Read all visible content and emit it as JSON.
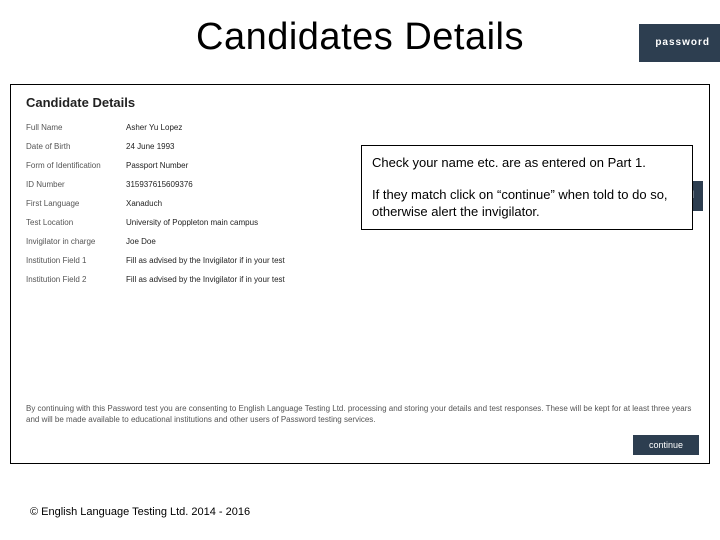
{
  "title": "Candidates Details",
  "logo_text": "password",
  "section_heading": "Candidate Details",
  "details": {
    "items": [
      {
        "label": "Full Name",
        "value": "Asher Yu Lopez"
      },
      {
        "label": "Date of Birth",
        "value": "24 June 1993"
      },
      {
        "label": "Form of Identification",
        "value": "Passport Number"
      },
      {
        "label": "ID Number",
        "value": "315937615609376"
      },
      {
        "label": "First Language",
        "value": "Xanaduch"
      },
      {
        "label": "Test Location",
        "value": "University of Poppleton main campus"
      },
      {
        "label": "Invigilator in charge",
        "value": "Joe Doe"
      },
      {
        "label": "Institution Field 1",
        "value": "Fill as advised by the Invigilator if in your test"
      },
      {
        "label": "Institution Field 2",
        "value": "Fill as advised by the Invigilator if in your test"
      }
    ]
  },
  "callout": {
    "p1": "Check your name etc. are as entered on Part 1.",
    "p2": "If they match click on “continue” when told to do so, otherwise alert the invigilator."
  },
  "consent_text": "By continuing with this Password test you are consenting to English Language Testing Ltd. processing and storing your details and test responses. These will be kept for at least three years and will be made available to educational institutions and other users of Password testing services.",
  "continue_label": "continue",
  "footer": "© English Language Testing Ltd. 2014 - 2016"
}
